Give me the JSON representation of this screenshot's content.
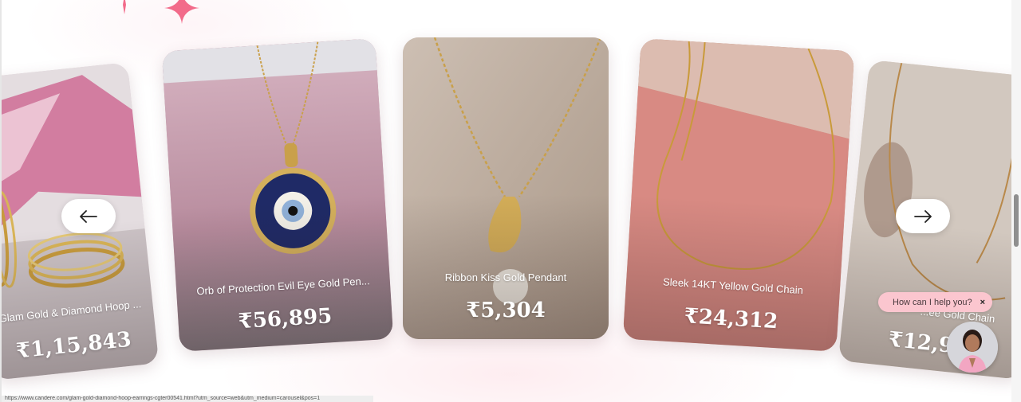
{
  "carousel": {
    "prev_icon": "arrow-left-icon",
    "next_icon": "arrow-right-icon",
    "products": [
      {
        "name": "Glam Gold & Diamond Hoop ...",
        "price": "₹1,15,843"
      },
      {
        "name": "Orb of Protection Evil Eye Gold Pen...",
        "price": "₹56,895"
      },
      {
        "name": "Ribbon Kiss Gold Pendant",
        "price": "₹5,304"
      },
      {
        "name": "Sleek 14KT Yellow Gold Chain",
        "price": "₹24,312"
      },
      {
        "name": "...ee Gold Chain",
        "price": "₹12,9"
      }
    ]
  },
  "chat_widget": {
    "prompt": "How can I help you?",
    "close_glyph": "×",
    "close_icon": "close-icon",
    "avatar_icon": "assistant-avatar"
  },
  "status_bar": {
    "url": "https://www.candere.com/glam-gold-diamond-hoop-earrings-cgter00541.html?utm_source=web&utm_medium=carousel&pos=1"
  },
  "decor": {
    "sparkle_color": "#f26b8a"
  }
}
